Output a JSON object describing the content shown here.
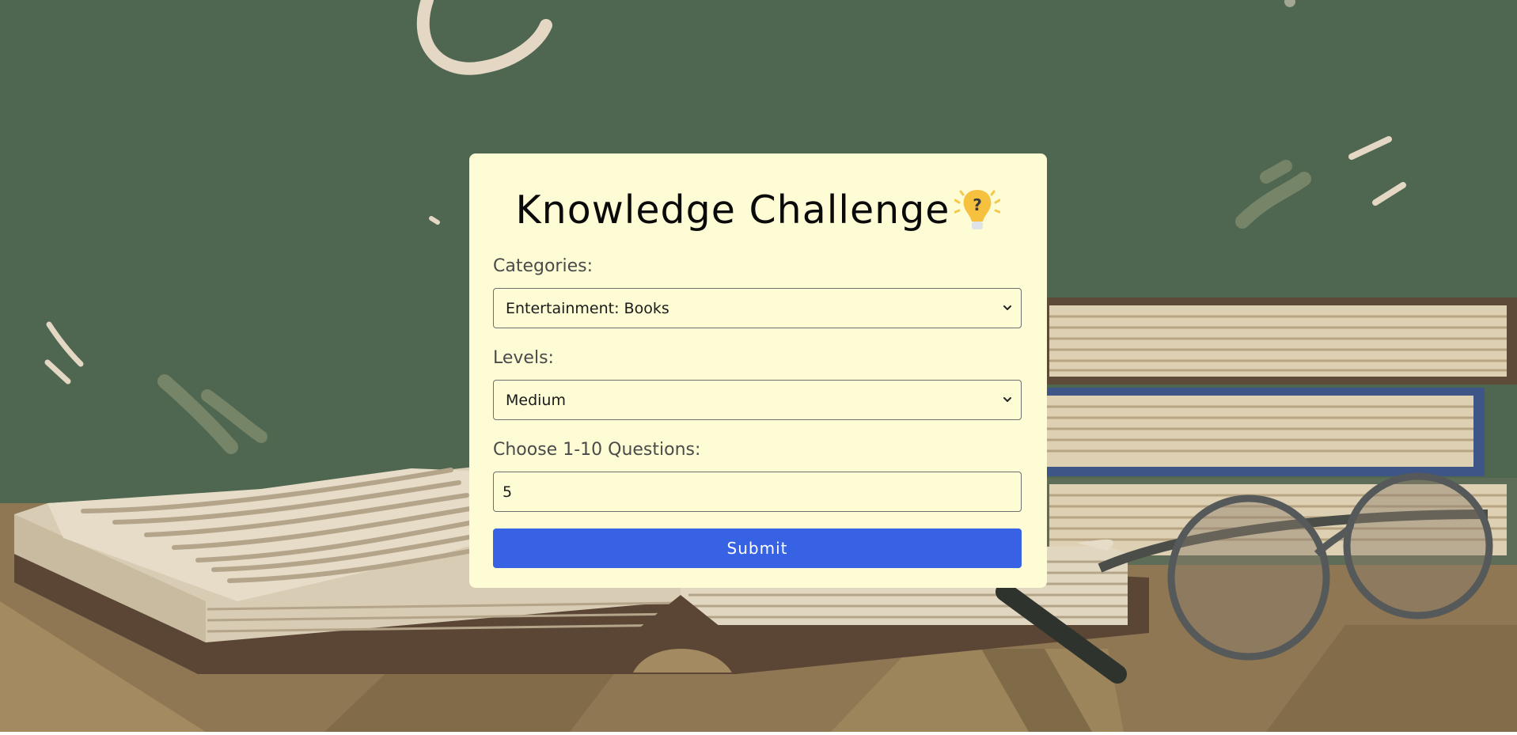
{
  "page": {
    "title": "Knowledge Challenge",
    "title_icon": "lightbulb-question-icon"
  },
  "form": {
    "category_label": "Categories:",
    "category_value": "Entertainment: Books",
    "level_label": "Levels:",
    "level_value": "Medium",
    "questions_label": "Choose 1-10 Questions:",
    "questions_value": "5",
    "submit_label": "Submit"
  },
  "colors": {
    "chalkboard": "#4f6650",
    "card": "#fefcd5",
    "submit": "#3762e3",
    "desk": "#8e7752"
  }
}
